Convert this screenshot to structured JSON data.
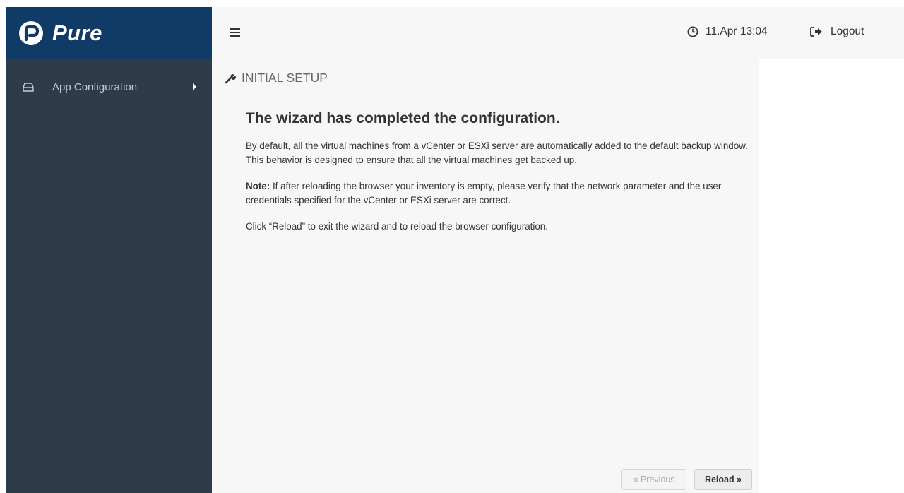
{
  "brand": {
    "name": "Pure",
    "color": "#0f3b66"
  },
  "sidebar": {
    "items": [
      {
        "label": "App Configuration",
        "icon": "hdd-icon"
      }
    ]
  },
  "header": {
    "menu_icon": "hamburger-icon",
    "datetime": "11.Apr 13:04",
    "logout_label": "Logout"
  },
  "main": {
    "section_title": "INITIAL SETUP",
    "heading": "The wizard has completed the configuration.",
    "paragraph1": "By default, all the virtual machines from a vCenter or ESXi server are automatically added to the default backup window. This behavior is designed to ensure that all the virtual machines get backed up.",
    "note_label": "Note:",
    "note_text": " If after reloading the browser your inventory is empty, please verify that the network parameter and the user credentials specified for the vCenter or ESXi server are correct.",
    "paragraph3": "Click “Reload” to exit the wizard and to reload the browser configuration.",
    "prev_button": "« Previous",
    "reload_button": "Reload »"
  }
}
